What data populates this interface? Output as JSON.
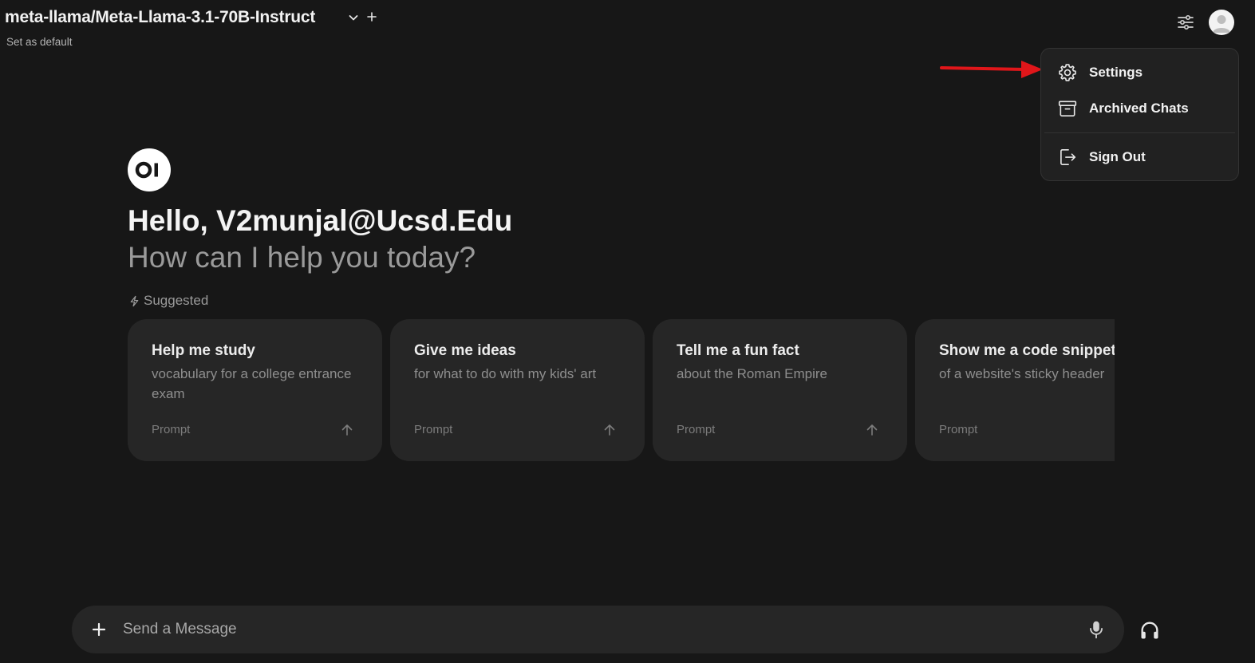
{
  "header": {
    "model_name": "meta-llama/Meta-Llama-3.1-70B-Instruct",
    "set_default_label": "Set as default"
  },
  "user_menu": {
    "items": [
      {
        "label": "Settings",
        "icon": "gear-icon"
      },
      {
        "label": "Archived Chats",
        "icon": "archive-icon"
      },
      {
        "label": "Sign Out",
        "icon": "sign-out-icon"
      }
    ]
  },
  "welcome": {
    "greeting": "Hello, V2munjal@Ucsd.Edu",
    "subtitle": "How can I help you today?",
    "suggested_label": "Suggested"
  },
  "suggestions": [
    {
      "title": "Help me study",
      "subtitle": "vocabulary for a college entrance exam",
      "tag": "Prompt"
    },
    {
      "title": "Give me ideas",
      "subtitle": "for what to do with my kids' art",
      "tag": "Prompt"
    },
    {
      "title": "Tell me a fun fact",
      "subtitle": "about the Roman Empire",
      "tag": "Prompt"
    },
    {
      "title": "Show me a code snippet",
      "subtitle": "of a website's sticky header",
      "tag": "Prompt"
    }
  ],
  "composer": {
    "placeholder": "Send a Message",
    "value": ""
  },
  "colors": {
    "background": "#171717",
    "card": "#262626",
    "menu": "#212121",
    "annotation_arrow": "#e0161a"
  }
}
